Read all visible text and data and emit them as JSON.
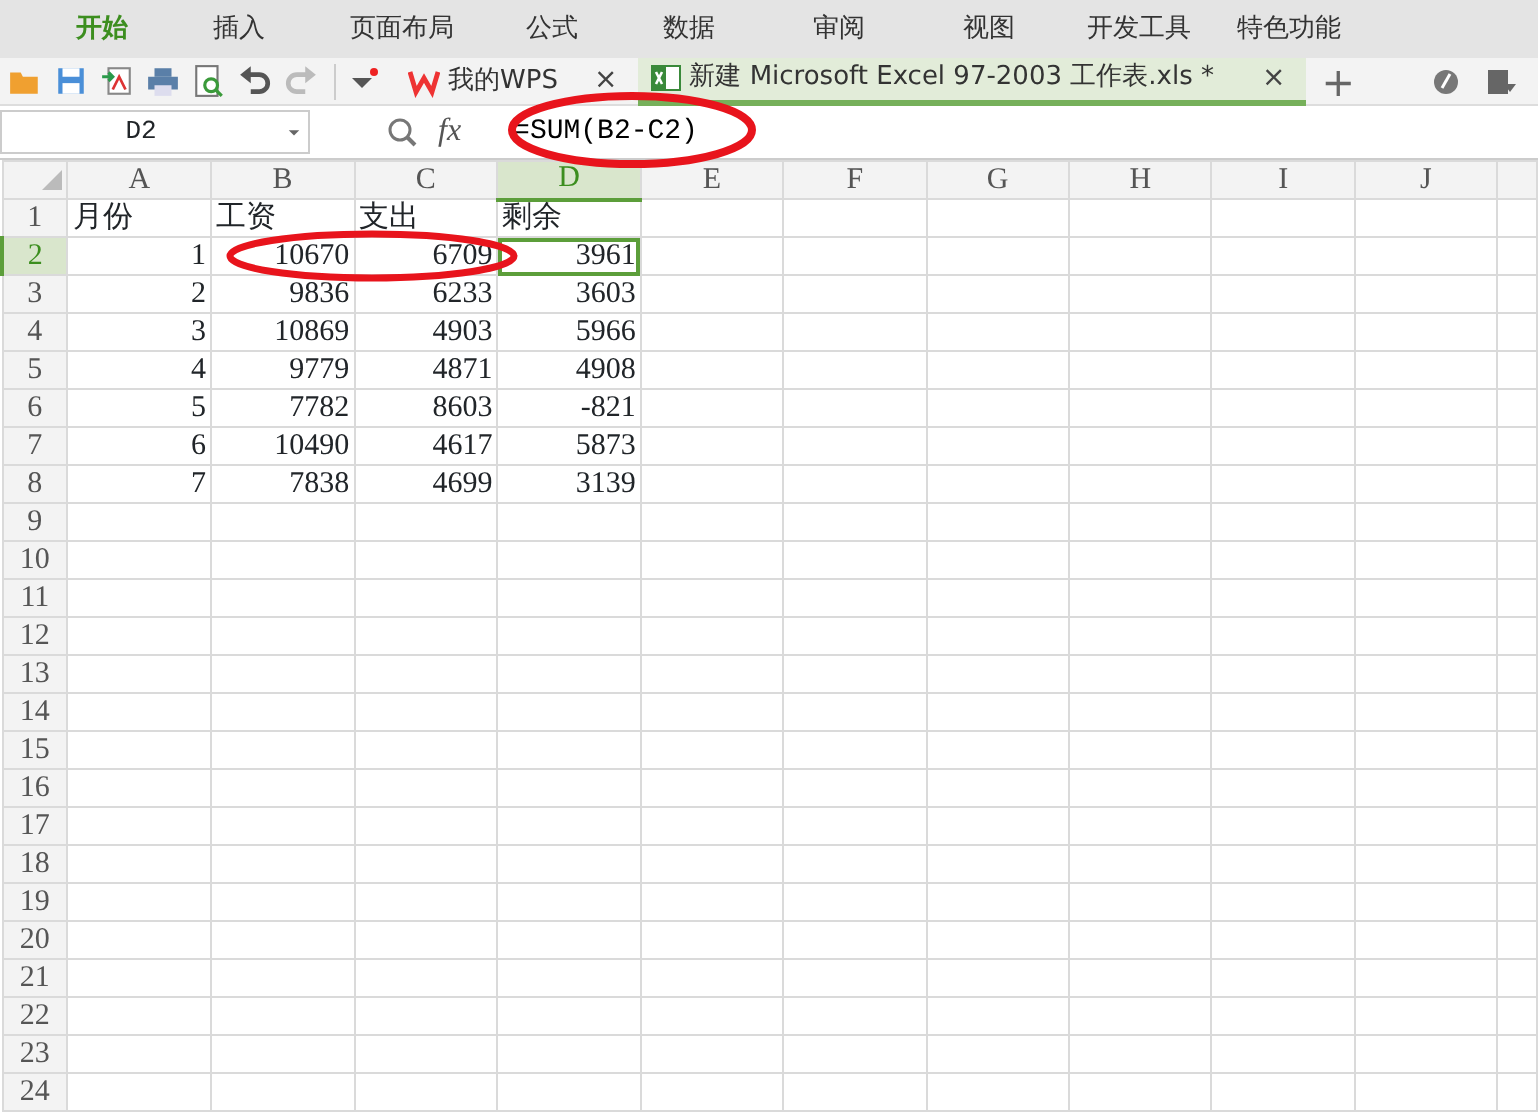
{
  "ribbon_tabs": [
    {
      "label": "开始",
      "selected": true
    },
    {
      "label": "插入",
      "selected": false
    },
    {
      "label": "页面布局",
      "selected": false
    },
    {
      "label": "公式",
      "selected": false
    },
    {
      "label": "数据",
      "selected": false
    },
    {
      "label": "审阅",
      "selected": false
    },
    {
      "label": "视图",
      "selected": false
    },
    {
      "label": "开发工具",
      "selected": false
    },
    {
      "label": "特色功能",
      "selected": false
    }
  ],
  "doc_tabs": [
    {
      "label": "我的WPS",
      "kind": "wps",
      "selected": false,
      "close": "×"
    },
    {
      "label": "新建 Microsoft Excel 97-2003 工作表.xls *",
      "kind": "sheet",
      "selected": true,
      "close": "×"
    }
  ],
  "new_tab": "+",
  "formula_bar": {
    "name_box": "D2",
    "fx": "fx",
    "formula": "=SUM(B2-C2)"
  },
  "columns": [
    {
      "label": "A",
      "selected": false
    },
    {
      "label": "B",
      "selected": false
    },
    {
      "label": "C",
      "selected": false
    },
    {
      "label": "D",
      "selected": true
    },
    {
      "label": "E",
      "selected": false
    },
    {
      "label": "F",
      "selected": false
    },
    {
      "label": "G",
      "selected": false
    },
    {
      "label": "H",
      "selected": false
    },
    {
      "label": "I",
      "selected": false
    },
    {
      "label": "J",
      "selected": false
    }
  ],
  "rows": [
    {
      "label": "1",
      "selected": false,
      "cells": [
        "月份",
        "工资",
        "支出",
        "剩余"
      ]
    },
    {
      "label": "2",
      "selected": true,
      "cells": [
        "1",
        "10670",
        "6709",
        "3961"
      ]
    },
    {
      "label": "3",
      "selected": false,
      "cells": [
        "2",
        "9836",
        "6233",
        "3603"
      ]
    },
    {
      "label": "4",
      "selected": false,
      "cells": [
        "3",
        "10869",
        "4903",
        "5966"
      ]
    },
    {
      "label": "5",
      "selected": false,
      "cells": [
        "4",
        "9779",
        "4871",
        "4908"
      ]
    },
    {
      "label": "6",
      "selected": false,
      "cells": [
        "5",
        "7782",
        "8603",
        "-821"
      ]
    },
    {
      "label": "7",
      "selected": false,
      "cells": [
        "6",
        "10490",
        "4617",
        "5873"
      ]
    },
    {
      "label": "8",
      "selected": false,
      "cells": [
        "7",
        "7838",
        "4699",
        "3139"
      ]
    },
    {
      "label": "9",
      "selected": false,
      "cells": []
    },
    {
      "label": "10",
      "selected": false,
      "cells": []
    },
    {
      "label": "11",
      "selected": false,
      "cells": []
    },
    {
      "label": "12",
      "selected": false,
      "cells": []
    },
    {
      "label": "13",
      "selected": false,
      "cells": []
    },
    {
      "label": "14",
      "selected": false,
      "cells": []
    },
    {
      "label": "15",
      "selected": false,
      "cells": []
    },
    {
      "label": "16",
      "selected": false,
      "cells": []
    },
    {
      "label": "17",
      "selected": false,
      "cells": []
    },
    {
      "label": "18",
      "selected": false,
      "cells": []
    },
    {
      "label": "19",
      "selected": false,
      "cells": []
    },
    {
      "label": "20",
      "selected": false,
      "cells": []
    },
    {
      "label": "21",
      "selected": false,
      "cells": []
    },
    {
      "label": "22",
      "selected": false,
      "cells": []
    },
    {
      "label": "23",
      "selected": false,
      "cells": []
    },
    {
      "label": "24",
      "selected": false,
      "cells": []
    }
  ]
}
